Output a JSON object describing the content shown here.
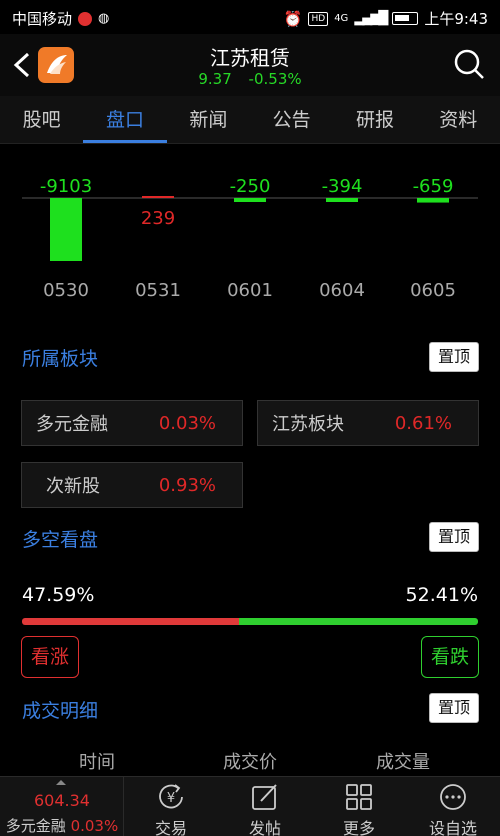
{
  "status_bar": {
    "carrier": "中国移动",
    "time": "上午9:43",
    "hd": "HD",
    "net": "4G"
  },
  "header": {
    "title": "江苏租赁",
    "price": "9.37",
    "change_pct": "-0.53%"
  },
  "tabs": [
    "股吧",
    "盘口",
    "新闻",
    "公告",
    "研报",
    "资料"
  ],
  "active_tab": 1,
  "chart_data": {
    "type": "bar",
    "categories": [
      "0530",
      "0531",
      "0601",
      "0604",
      "0605"
    ],
    "values": [
      -9103,
      239,
      -250,
      -394,
      -659
    ],
    "value_labels": [
      "-9103",
      "239",
      "-250",
      "-394",
      "-659"
    ],
    "colors": {
      "negative": "#1ee01e",
      "positive": "#e02828"
    }
  },
  "sectors": {
    "title": "所属板块",
    "pin_label": "置顶",
    "items": [
      {
        "name": "多元金融",
        "change": "0.03%"
      },
      {
        "name": "江苏板块",
        "change": "0.61%"
      },
      {
        "name": "次新股",
        "change": "0.93%"
      }
    ]
  },
  "bullbear": {
    "title": "多空看盘",
    "pin_label": "置顶",
    "bull_pct_text": "47.59%",
    "bear_pct_text": "52.41%",
    "bull_fraction": 0.4759,
    "bull_button": "看涨",
    "bear_button": "看跌"
  },
  "trades": {
    "title": "成交明细",
    "pin_label": "置顶",
    "columns": [
      "时间",
      "成交价",
      "成交量"
    ]
  },
  "bottom_bar": {
    "index_value": "604.34",
    "index_name": "多元金融",
    "index_change": "0.03%",
    "items": [
      "交易",
      "发帖",
      "更多",
      "设自选"
    ]
  }
}
